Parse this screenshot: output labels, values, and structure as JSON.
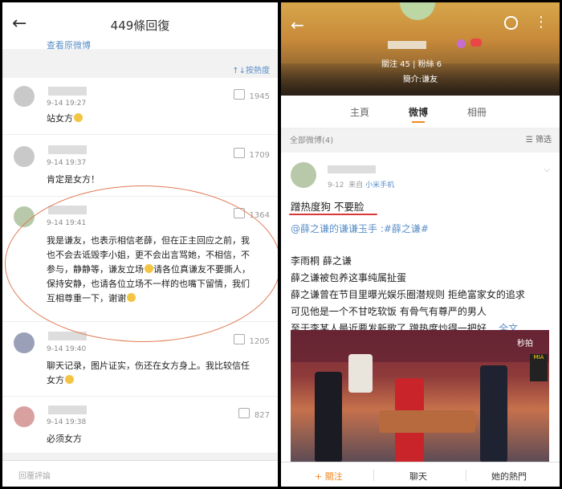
{
  "left": {
    "header": {
      "back_icon": "←",
      "title": "449條回復",
      "original_link": "查看原微博"
    },
    "sort_label": "↑↓按熱度",
    "comments": [
      {
        "time": "9-14 19:27",
        "likes": "1945",
        "text": "站女方"
      },
      {
        "time": "9-14 19:37",
        "likes": "1709",
        "text": "肯定是女方！"
      },
      {
        "time": "9-14 19:41",
        "likes": "1364",
        "lines": [
          "我是谦友，也表示相信老薛，但在正主回应之前，我",
          "也不会去诋毁李小姐，更不会出言骂她，不相信，不",
          "参与，静静等，谦友立场",
          "保持安静，也请各位立场不一样的也嘴下留情，我们",
          "互相尊重一下，谢谢"
        ],
        "line3_after_emoji": "请各位真谦友不要撕人，"
      },
      {
        "time": "9-14 19:40",
        "likes": "1205",
        "lines": [
          "聊天记录，图片证实，伤还在女方身上。我比较信任",
          "女方"
        ]
      },
      {
        "time": "9-14 19:38",
        "likes": "827",
        "text": "必须女方"
      }
    ],
    "reply_placeholder": "回覆評論"
  },
  "right": {
    "header": {
      "back_icon": "←",
      "more_icon": "⋮"
    },
    "stats": "關注 45  |  粉絲 6",
    "intro": "簡介:谦友",
    "tabs": [
      "主頁",
      "微博",
      "相冊"
    ],
    "active_tab": "微博",
    "all_posts": "全部微博(4)",
    "filter": "筛选",
    "post": {
      "time": "9-12",
      "source_prefix": "来自",
      "source": "小米手机",
      "headline": "蹭热度狗 不要脸",
      "tags": "@薛之谦的谦谦玉手 :#薛之谦#",
      "body": [
        "李雨桐 薛之谦",
        "薛之谦被包养这事纯属扯蛋",
        "薛之谦曾在节目里曝光娱乐圈潜规则 拒绝富家女的追求",
        "可见他是一个不甘吃软饭 有骨气有尊严的男人"
      ],
      "last_line": "至于李某人最近要发新歌了 蹭热度炒得一把好...",
      "more": "全文"
    },
    "video": {
      "brand": "秒拍",
      "watermark": "MIA"
    },
    "footer": {
      "follow": "+ 關注",
      "chat": "聊天",
      "hot": "她的熱門"
    }
  }
}
